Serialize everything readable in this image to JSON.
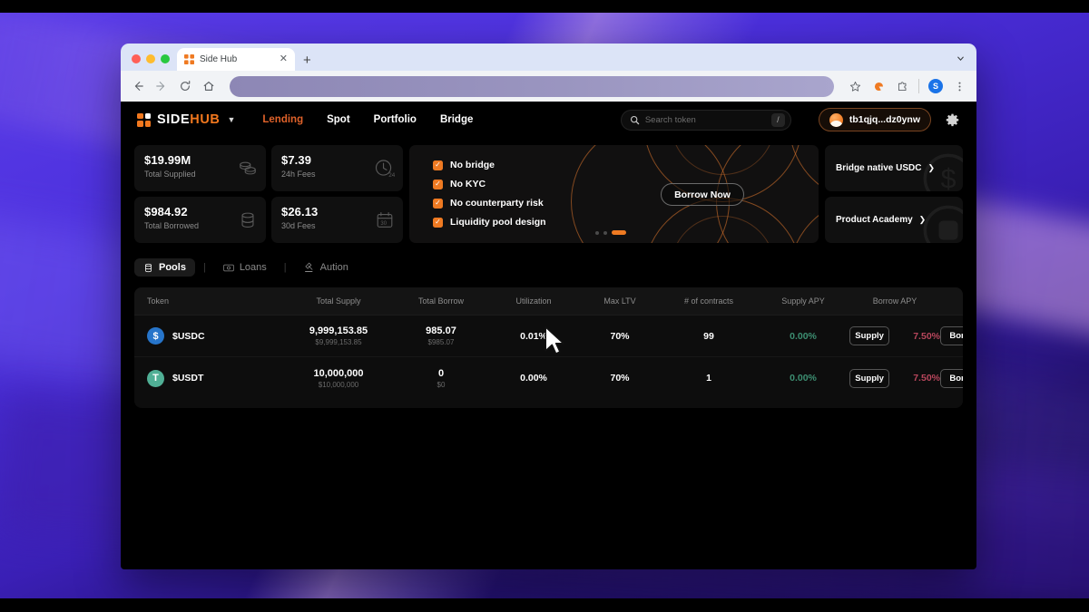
{
  "browser": {
    "tab": {
      "title": "Side Hub",
      "favicon_icon": "sidehub-favicon",
      "close_icon": "close-icon"
    },
    "new_tab_icon": "plus-icon",
    "tab_list_chevron_icon": "chevron-down-icon",
    "nav": {
      "back_icon": "arrow-left-icon",
      "forward_icon": "arrow-right-icon",
      "reload_icon": "reload-icon",
      "home_icon": "home-icon",
      "omnibox_value": "",
      "bookmark_icon": "star-icon",
      "extension_icon": "extension-orange-icon",
      "extensions_icon": "puzzle-icon",
      "profile_initial": "S",
      "menu_icon": "three-dot-menu-icon"
    },
    "traffic_lights": [
      "close-red",
      "minimize-yellow",
      "maximize-green"
    ]
  },
  "app": {
    "logo": {
      "side": "SIDE",
      "hub": "HUB",
      "caret_icon": "chevron-down-icon"
    },
    "nav_links": [
      {
        "label": "Lending",
        "active": true
      },
      {
        "label": "Spot",
        "active": false
      },
      {
        "label": "Portfolio",
        "active": false
      },
      {
        "label": "Bridge",
        "active": false
      }
    ],
    "search": {
      "placeholder": "Search token",
      "value": "",
      "shortcut": "/",
      "icon": "search-icon"
    },
    "wallet": {
      "address": "tb1qjq...dz0ynw",
      "avatar_icon": "wallet-avatar-icon"
    },
    "settings_icon": "gear-icon",
    "stats": [
      {
        "value": "$19.99M",
        "label": "Total Supplied",
        "icon": "coins-stack-icon"
      },
      {
        "value": "$7.39",
        "label": "24h Fees",
        "icon": "clock-24-icon"
      },
      {
        "value": "$984.92",
        "label": "Total Borrowed",
        "icon": "database-icon"
      },
      {
        "value": "$26.13",
        "label": "30d Fees",
        "icon": "calendar-30-icon"
      }
    ],
    "promo": {
      "features": [
        "No bridge",
        "No KYC",
        "No counterparty risk",
        "Liquidity pool design"
      ],
      "cta_label": "Borrow Now",
      "dots": [
        false,
        false,
        true
      ]
    },
    "side_cards": [
      {
        "label": "Bridge native USDC",
        "arrow_icon": "chevron-right-icon",
        "bg_icon": "usdc-icon"
      },
      {
        "label": "Product Academy",
        "arrow_icon": "chevron-right-icon",
        "bg_icon": "academy-icon"
      }
    ],
    "sub_tabs": [
      {
        "label": "Pools",
        "icon": "database-icon",
        "active": true
      },
      {
        "label": "Loans",
        "icon": "banknote-icon",
        "active": false
      },
      {
        "label": "Aution",
        "icon": "gavel-icon",
        "active": false
      }
    ],
    "table": {
      "columns": [
        "Token",
        "Total Supply",
        "Total Borrow",
        "Utilization",
        "Max LTV",
        "# of contracts",
        "Supply APY",
        "",
        "Borrow APY",
        ""
      ],
      "headers": [
        "Token",
        "Total Supply",
        "Total Borrow",
        "Utilization",
        "Max LTV",
        "# of contracts",
        "Supply APY",
        "Borrow APY"
      ],
      "rows": [
        {
          "token": "$USDC",
          "token_icon": "usdc-icon",
          "token_color": "#2775ca",
          "total_supply": "9,999,153.85",
          "total_supply_usd": "$9,999,153.85",
          "total_borrow": "985.07",
          "total_borrow_usd": "$985.07",
          "utilization": "0.01%",
          "max_ltv": "70%",
          "contracts": "99",
          "supply_apy": "0.00%",
          "supply_label": "Supply",
          "borrow_apy": "7.50%",
          "borrow_label": "Borrow"
        },
        {
          "token": "$USDT",
          "token_icon": "usdt-icon",
          "token_color": "#50af95",
          "total_supply": "10,000,000",
          "total_supply_usd": "$10,000,000",
          "total_borrow": "0",
          "total_borrow_usd": "$0",
          "utilization": "0.00%",
          "max_ltv": "70%",
          "contracts": "1",
          "supply_apy": "0.00%",
          "supply_label": "Supply",
          "borrow_apy": "7.50%",
          "borrow_label": "Borrow"
        }
      ]
    }
  },
  "colors": {
    "accent_orange": "#ef7a22",
    "lending_active": "#e0622a",
    "supply_apy_green": "#3d8f72",
    "borrow_apy_red": "#b8465c",
    "app_bg": "#000000",
    "card_bg": "#101010"
  }
}
